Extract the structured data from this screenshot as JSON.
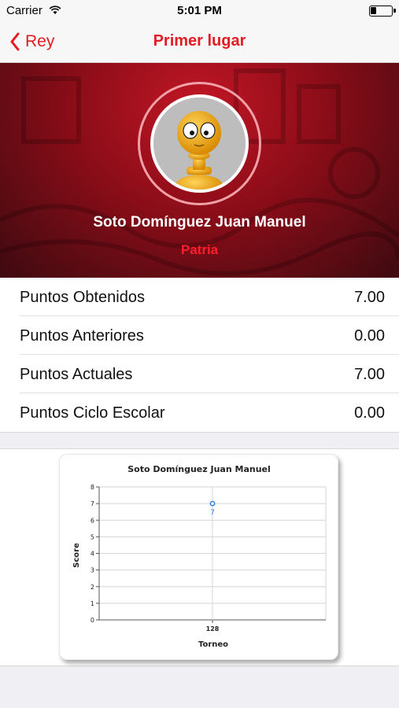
{
  "status_bar": {
    "carrier": "Carrier",
    "time": "5:01 PM",
    "wifi_icon": "wifi-icon",
    "battery_icon": "battery-icon"
  },
  "nav": {
    "back_label": "Rey",
    "back_icon": "chevron-left-icon",
    "title": "Primer lugar",
    "accent_color": "#e31b23"
  },
  "profile": {
    "name": "Soto Domínguez Juan Manuel",
    "team": "Patria",
    "avatar_icon": "chess-pawn-avatar-icon"
  },
  "stats": [
    {
      "label": "Puntos Obtenidos",
      "value": "7.00"
    },
    {
      "label": "Puntos Anteriores",
      "value": "0.00"
    },
    {
      "label": "Puntos Actuales",
      "value": "7.00"
    },
    {
      "label": "Puntos Ciclo Escolar",
      "value": "0.00"
    }
  ],
  "chart_data": {
    "type": "line",
    "title": "Soto Domínguez Juan Manuel",
    "xlabel": "Torneo",
    "ylabel": "Score",
    "categories": [
      "128"
    ],
    "series": [
      {
        "values": [
          7
        ],
        "data_labels": [
          "7"
        ],
        "color": "#2a7fe0"
      }
    ],
    "ylim": [
      0,
      8
    ],
    "yticks": [
      "0",
      "1",
      "2",
      "3",
      "4",
      "5",
      "6",
      "7",
      "8"
    ],
    "grid": true
  }
}
